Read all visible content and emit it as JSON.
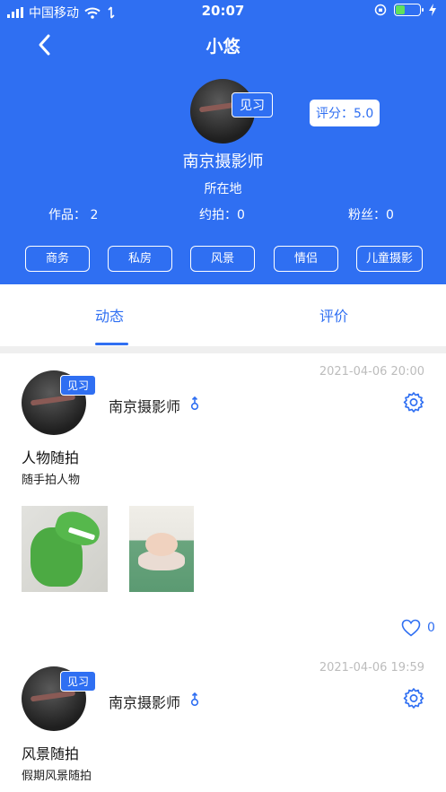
{
  "status_bar": {
    "carrier": "中国移动",
    "time": "20:07"
  },
  "nav": {
    "title": "小悠"
  },
  "profile": {
    "badge": "见习",
    "rating": "评分：5.0",
    "name": "南京摄影师",
    "location": "所在地",
    "stats": {
      "works": "作品： 2",
      "bookings": "约拍：0",
      "fans": "粉丝：0"
    },
    "tags": [
      "商务",
      "私房",
      "风景",
      "情侣",
      "儿童摄影"
    ]
  },
  "tabs": [
    {
      "label": "动态",
      "active": true
    },
    {
      "label": "评价",
      "active": false
    }
  ],
  "posts": [
    {
      "time": "2021-04-06 20:00",
      "badge": "见习",
      "user": "南京摄影师",
      "title": "人物随拍",
      "desc": "随手拍人物",
      "likes": "0"
    },
    {
      "time": "2021-04-06 19:59",
      "badge": "见习",
      "user": "南京摄影师",
      "title": "风景随拍",
      "desc": "假期风景随拍"
    }
  ],
  "colors": {
    "primary": "#2f6ff2",
    "battery": "#5fe05c"
  },
  "icons": [
    "back-icon",
    "settings-gear-icon",
    "heart-icon",
    "male-gender-icon",
    "wifi-icon",
    "signal-icon",
    "battery-icon"
  ]
}
